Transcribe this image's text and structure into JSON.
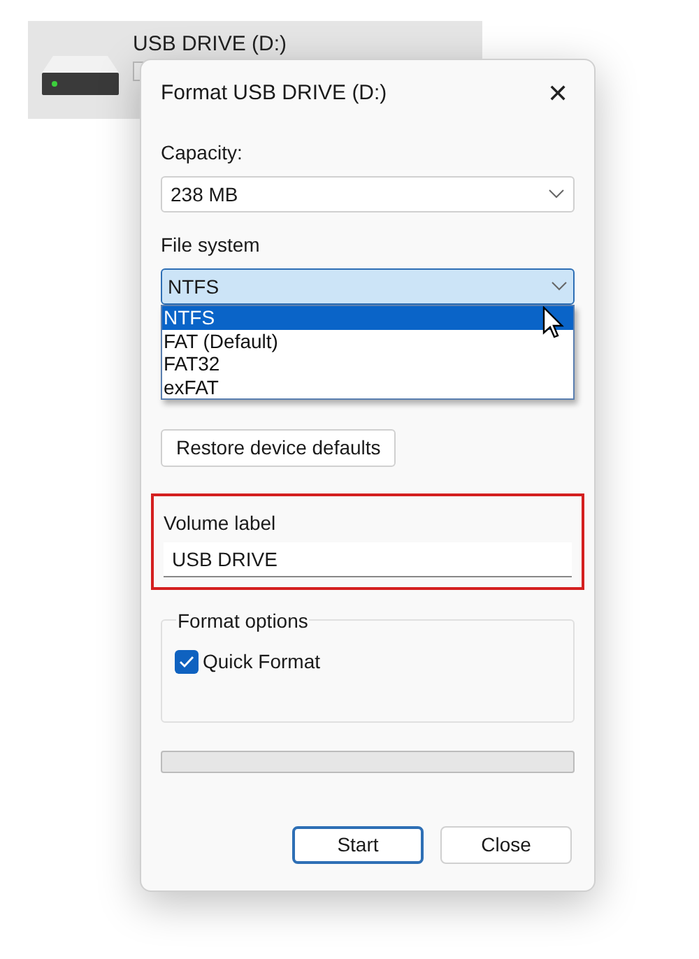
{
  "background_item": {
    "title": "USB DRIVE (D:)"
  },
  "dialog": {
    "title": "Format USB DRIVE (D:)",
    "close": "✕",
    "capacity": {
      "label": "Capacity:",
      "value": "238 MB"
    },
    "file_system": {
      "label": "File system",
      "value": "NTFS",
      "expanded": true,
      "options": [
        {
          "label": "NTFS",
          "selected": true
        },
        {
          "label": "FAT (Default)",
          "selected": false
        },
        {
          "label": "FAT32",
          "selected": false
        },
        {
          "label": "exFAT",
          "selected": false
        }
      ]
    },
    "restore_button": "Restore device defaults",
    "volume_label": {
      "label": "Volume label",
      "value": "USB DRIVE",
      "highlighted": true
    },
    "format_options": {
      "legend": "Format options",
      "quick_format": {
        "label": "Quick Format",
        "checked": true
      }
    },
    "progress": {
      "level": 0
    },
    "buttons": [
      {
        "label": "Start",
        "default": true
      },
      {
        "label": "Close",
        "default": false
      }
    ]
  }
}
